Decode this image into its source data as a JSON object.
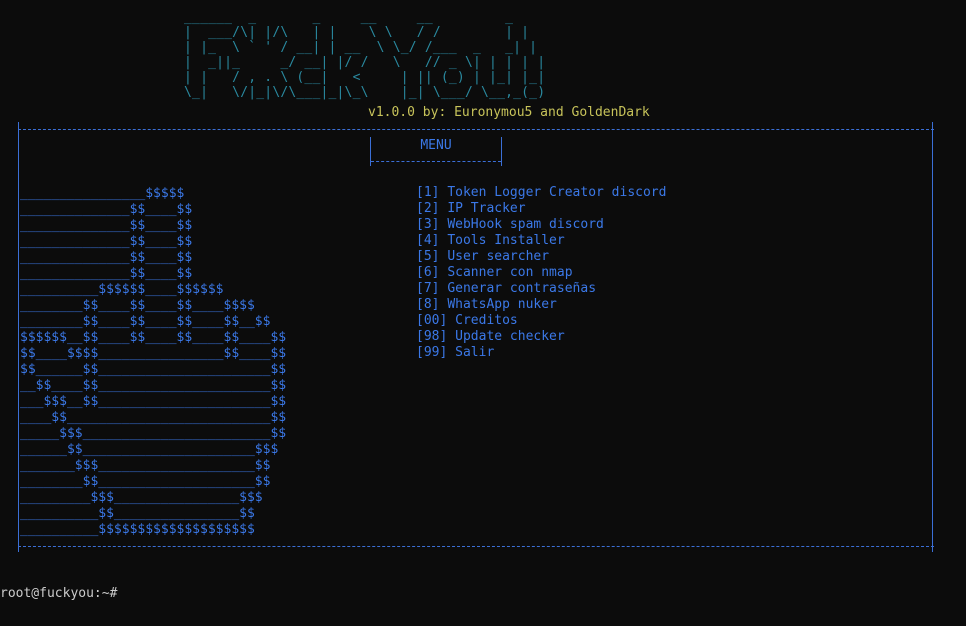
{
  "banner": {
    "ascii": " ______  _       _     __     __         _ \n |  ___/\\| |/\\   | |    \\ \\   / /        | |\n | |_  \\ ` ' / __| | __  \\ \\_/ /___  _   _| |\n |  _||_     _/ __| |/ /   \\   // _ \\| | | | |\n | |   / , . \\ (__|   <     | || (_) | |_| |_|\n \\_|   \\/|_|\\/\\___|_|\\_\\    |_| \\___/ \\__,_(_)",
    "version_line": "v1.0.0 by: Euronymou5 and GoldenDark"
  },
  "menu": {
    "title": "MENU",
    "items": [
      {
        "key": "[1]",
        "label": "Token Logger Creator discord"
      },
      {
        "key": "[2]",
        "label": "IP Tracker"
      },
      {
        "key": "[3]",
        "label": "WebHook spam discord"
      },
      {
        "key": "[4]",
        "label": "Tools Installer"
      },
      {
        "key": "[5]",
        "label": "User searcher"
      },
      {
        "key": "[6]",
        "label": "Scanner con nmap"
      },
      {
        "key": "[7]",
        "label": "Generar contraseñas"
      },
      {
        "key": "[8]",
        "label": "WhatsApp nuker"
      },
      {
        "key": "[00]",
        "label": "Creditos"
      },
      {
        "key": "[98]",
        "label": "Update checker"
      },
      {
        "key": "[99]",
        "label": "Salir"
      }
    ]
  },
  "art": {
    "lines": [
      "________________$$$$$",
      "______________$$____$$",
      "______________$$____$$",
      "______________$$____$$",
      "______________$$____$$",
      "______________$$____$$",
      "__________$$$$$$____$$$$$$",
      "________$$____$$____$$____$$$$",
      "________$$____$$____$$____$$__$$",
      "$$$$$$__$$____$$____$$____$$____$$",
      "$$____$$$$________________$$____$$",
      "$$______$$______________________$$",
      "__$$____$$______________________$$",
      "___$$$__$$______________________$$",
      "____$$__________________________$$",
      "_____$$$________________________$$",
      "______$$______________________$$$",
      "_______$$$____________________$$",
      "________$$____________________$$",
      "_________$$$________________$$$",
      "__________$$________________$$",
      "__________$$$$$$$$$$$$$$$$$$$$"
    ]
  },
  "prompt": {
    "text": "root@fuckyou:~#"
  },
  "colors": {
    "background": "#0c0c0c",
    "banner": "#2a8aa0",
    "version": "#c7c35a",
    "menu": "#3b78e7",
    "prompt": "#cccccc"
  }
}
